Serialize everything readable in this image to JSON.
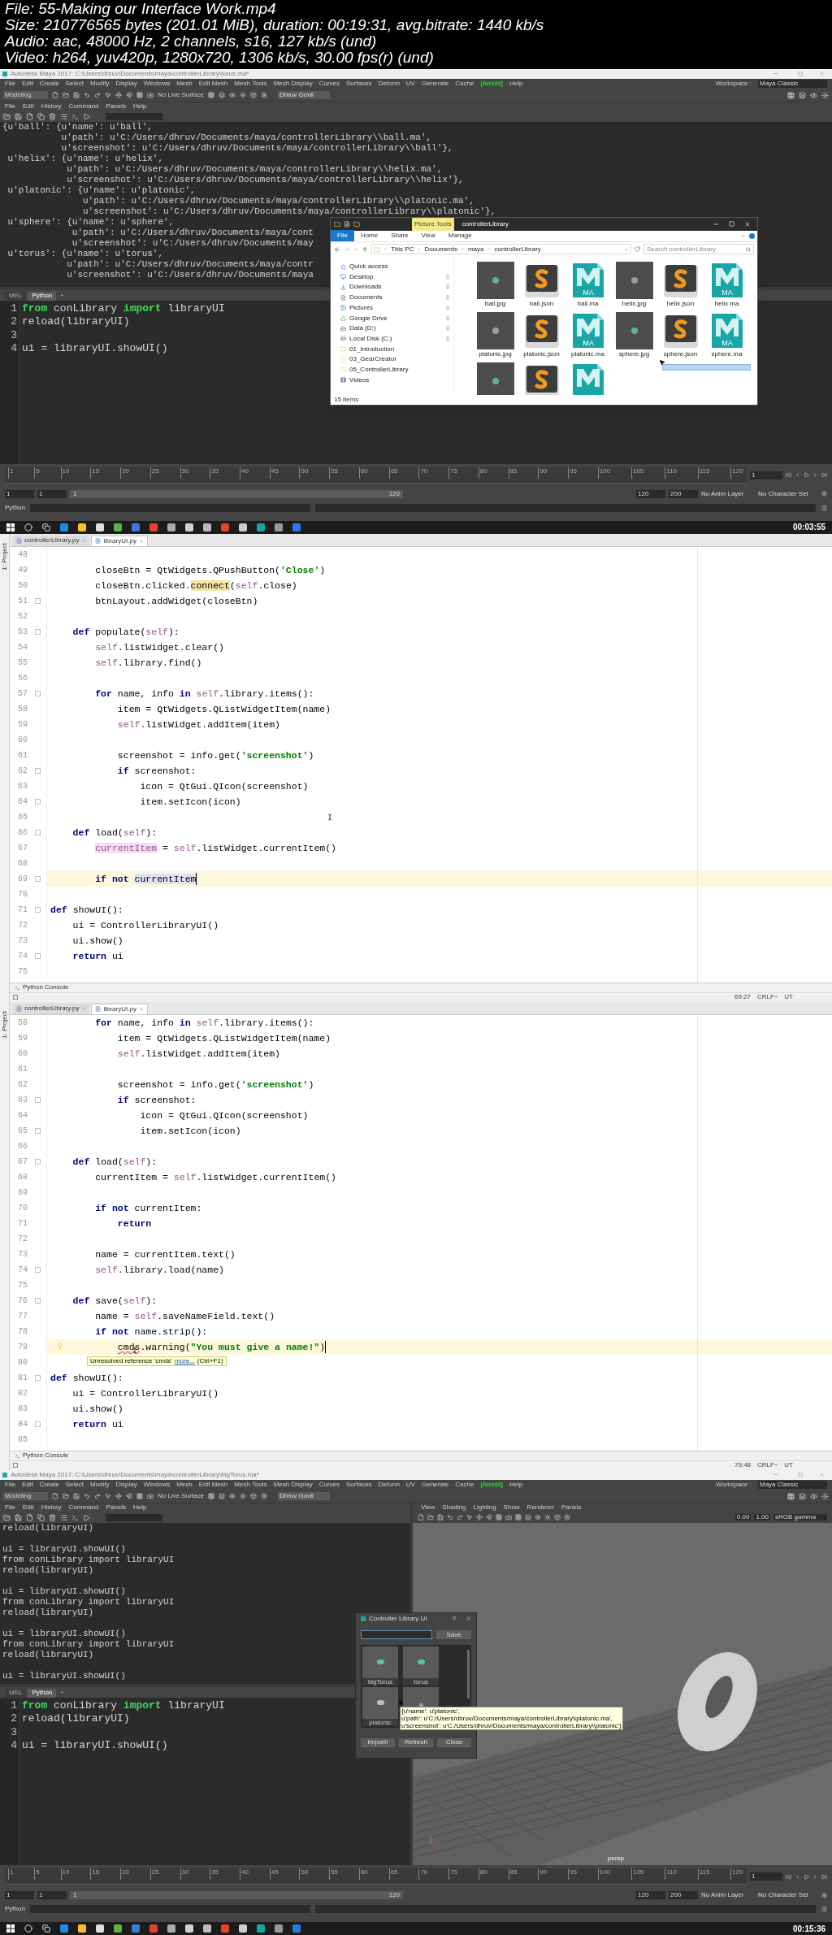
{
  "file_info": [
    "File: 55-Making our Interface Work.mp4",
    "Size: 210776565 bytes (201.01 MiB), duration: 00:19:31, avg.bitrate: 1440 kb/s",
    "Audio: aac, 48000 Hz, 2 channels, s16, 127 kb/s (und)",
    "Video: h264, yuv420p, 1280x720, 1306 kb/s, 30.00 fps(r) (und)"
  ],
  "frames": [
    {
      "kind": "maya",
      "title": "Autodesk Maya 2017: C:\\Users\\dhruv\\Documents\\maya\\controllerLibrary\\torus.ma*",
      "menu": [
        {
          "label": "File",
          "kind": "menu"
        },
        {
          "label": "Edit",
          "kind": "menu"
        },
        {
          "label": "Create",
          "kind": "menu"
        },
        {
          "label": "Select",
          "kind": "menu"
        },
        {
          "label": "Modify",
          "kind": "menu"
        },
        {
          "label": "Display",
          "kind": "menu"
        },
        {
          "label": "Windows",
          "kind": "menu"
        },
        {
          "label": "Mesh",
          "kind": "menu"
        },
        {
          "label": "Edit Mesh",
          "kind": "menu"
        },
        {
          "label": "Mesh Tools",
          "kind": "menu"
        },
        {
          "label": "Mesh Display",
          "kind": "menu"
        },
        {
          "label": "Curves",
          "kind": "menu"
        },
        {
          "label": "Surfaces",
          "kind": "menu"
        },
        {
          "label": "Deform",
          "kind": "menu"
        },
        {
          "label": "UV",
          "kind": "menu"
        },
        {
          "label": "Generate",
          "kind": "menu"
        },
        {
          "label": "Cache",
          "kind": "menu"
        },
        {
          "label": "[Arnold]",
          "kind": "plugin"
        },
        {
          "label": "Help",
          "kind": "menu"
        }
      ],
      "workspace_label": "Workspace :",
      "workspace": "Maya Classic",
      "mode": "Modeling",
      "live_surface": "No Live Surface",
      "user": "Dhruv Govil",
      "script_menu": [
        "File",
        "Edit",
        "History",
        "Command",
        "Panels",
        "Help"
      ],
      "output_blocks": [
        [
          "{u'ball': {u'name': u'ball',",
          "           u'path': u'C:/Users/dhruv/Documents/maya/controllerLibrary\\\\ball.ma',",
          "           u'screenshot': u'C:/Users/dhruv/Documents/maya/controllerLibrary\\\\ball'},",
          " u'helix': {u'name': u'helix',",
          "            u'path': u'C:/Users/dhruv/Documents/maya/controllerLibrary\\\\helix.ma',",
          "            u'screenshot': u'C:/Users/dhruv/Documents/maya/controllerLibrary\\\\helix'},",
          " u'platonic': {u'name': u'platonic',",
          "               u'path': u'C:/Users/dhruv/Documents/maya/controllerLibrary\\\\platonic.ma',",
          "               u'screenshot': u'C:/Users/dhruv/Documents/maya/controllerLibrary\\\\platonic'},",
          " u'sphere': {u'name': u'sphere',",
          "             u'path': u'C:/Users/dhruv/Documents/maya/cont",
          "             u'screenshot': u'C:/Users/dhruv/Documents/may",
          " u'torus': {u'name': u'torus',",
          "            u'path': u'C:/Users/dhruv/Documents/maya/contr",
          "            u'screenshot': u'C:/Users/dhruv/Documents/maya"
        ]
      ],
      "tabs": [
        {
          "label": "MEL",
          "selected": false
        },
        {
          "label": "Python",
          "selected": true
        }
      ],
      "add_tab": "+",
      "input": [
        {
          "n": "1",
          "code": [
            {
              "kind": "keyword",
              "text": "from"
            },
            {
              "kind": "plain",
              "text": " conLibrary "
            },
            {
              "kind": "keyword",
              "text": "import"
            },
            {
              "kind": "plain",
              "text": " libraryUI"
            }
          ]
        },
        {
          "n": "2",
          "code": [
            {
              "kind": "plain",
              "text": "reload(libraryUI)"
            }
          ]
        },
        {
          "n": "3"
        },
        {
          "n": "4",
          "code": [
            {
              "kind": "plain",
              "text": "ui = libraryUI.showUI()"
            }
          ]
        }
      ],
      "overlay": {
        "kind": "explorer",
        "ribbon_badge": "Picture Tools",
        "title": "controllerLibrary",
        "ribbon_tabs": [
          {
            "label": "File",
            "selected": true
          },
          {
            "label": "Home",
            "selected": false
          },
          {
            "label": "Share",
            "selected": false
          },
          {
            "label": "View",
            "selected": false
          },
          {
            "label": "Manage",
            "selected": false
          }
        ],
        "breadcrumb": [
          "This PC",
          "Documents",
          "maya",
          "controllerLibrary"
        ],
        "search_placeholder": "Search controllerLibrary",
        "nav": [
          {
            "label": "Quick access",
            "kind": "star",
            "pinned": false
          },
          {
            "label": "Desktop",
            "kind": "desktop",
            "pinned": true
          },
          {
            "label": "Downloads",
            "kind": "download",
            "pinned": true
          },
          {
            "label": "Documents",
            "kind": "document",
            "pinned": true
          },
          {
            "label": "Pictures",
            "kind": "picture",
            "pinned": true
          },
          {
            "label": "Google Drive",
            "kind": "drive",
            "pinned": true
          },
          {
            "label": "Data (D:)",
            "kind": "disk",
            "pinned": true
          },
          {
            "label": "Local Disk (C:)",
            "kind": "disk",
            "pinned": true
          },
          {
            "label": "01_Introduction",
            "kind": "folder",
            "pinned": false
          },
          {
            "label": "03_GearCreator",
            "kind": "folder",
            "pinned": false
          },
          {
            "label": "05_ControllerLibrary",
            "kind": "folder",
            "pinned": false
          },
          {
            "label": "Videos",
            "kind": "video",
            "pinned": false
          }
        ],
        "files": [
          {
            "name": "ball.jpg",
            "kind": "jpg",
            "color": "#5fb38f"
          },
          {
            "name": "ball.json",
            "kind": "json"
          },
          {
            "name": "ball.ma",
            "kind": "ma",
            "badge": "MA"
          },
          {
            "name": "helix.jpg",
            "kind": "jpg",
            "color": "#9a9a9a"
          },
          {
            "name": "helix.json",
            "kind": "json"
          },
          {
            "name": "helix.ma",
            "kind": "ma",
            "badge": "MA"
          },
          {
            "name": "platonic.jpg",
            "kind": "jpg",
            "color": "#a0a0a0"
          },
          {
            "name": "platonic.json",
            "kind": "json"
          },
          {
            "name": "platonic.ma",
            "kind": "ma",
            "badge": "MA"
          },
          {
            "name": "sphere.jpg",
            "kind": "jpg",
            "color": "#5fb38f"
          },
          {
            "name": "sphere.json",
            "kind": "json"
          },
          {
            "name": "sphere.ma",
            "kind": "ma",
            "badge": "MA"
          },
          {
            "kind": "jpg",
            "color": "#5fb38f"
          },
          {
            "kind": "json"
          },
          {
            "kind": "ma"
          }
        ],
        "status": "15 items"
      },
      "timeline": {
        "ticks": [
          "1",
          "5",
          "10",
          "15",
          "20",
          "25",
          "30",
          "35",
          "40",
          "45",
          "50",
          "55",
          "60",
          "65",
          "70",
          "75",
          "80",
          "85",
          "90",
          "95",
          "100",
          "105",
          "110",
          "115",
          "120"
        ],
        "current": "1"
      },
      "range": {
        "start": "1",
        "inner_start": "1",
        "slider_start": "1",
        "slider_end": "120",
        "level": 1,
        "end": "120",
        "max": "200",
        "anim_layer": "No Anim Layer",
        "char_set": "No Character Set"
      },
      "command_label": "Python",
      "taskbar": {
        "time": "00:03:55"
      }
    },
    {
      "kind": "pycharm",
      "project_label": "1: Project",
      "tabs": [
        {
          "label": "controllerLibrary.py",
          "selected": false
        },
        {
          "label": "libraryUI.py",
          "selected": true
        }
      ],
      "bulb": false,
      "lines": [
        {
          "n": "48",
          "fold": false,
          "current": false
        },
        {
          "n": "49",
          "fold": false,
          "current": false,
          "code": [
            {
              "kind": "plain",
              "text": "        closeBtn = QtWidgets.QPushButton("
            },
            {
              "kind": "string",
              "text": "'Close'"
            },
            {
              "kind": "plain",
              "text": ")"
            }
          ]
        },
        {
          "n": "50",
          "fold": false,
          "current": false,
          "code": [
            {
              "kind": "plain",
              "text": "        closeBtn.clicked."
            },
            {
              "kind": "match",
              "text": "connect"
            },
            {
              "kind": "plain",
              "text": "("
            },
            {
              "kind": "self",
              "text": "self"
            },
            {
              "kind": "plain",
              "text": ".close)"
            }
          ]
        },
        {
          "n": "51",
          "fold": true,
          "current": false,
          "code": [
            {
              "kind": "plain",
              "text": "        btnLayout.addWidget(closeBtn)"
            }
          ]
        },
        {
          "n": "52",
          "fold": false,
          "current": false
        },
        {
          "n": "53",
          "fold": true,
          "current": false,
          "code": [
            {
              "kind": "keyword",
              "text": "    def"
            },
            {
              "kind": "plain",
              "text": " populate("
            },
            {
              "kind": "self",
              "text": "self"
            },
            {
              "kind": "plain",
              "text": "):"
            }
          ]
        },
        {
          "n": "54",
          "fold": false,
          "current": false,
          "code": [
            {
              "kind": "self",
              "text": "        self"
            },
            {
              "kind": "plain",
              "text": ".listWidget.clear()"
            }
          ]
        },
        {
          "n": "55",
          "fold": false,
          "current": false,
          "code": [
            {
              "kind": "self",
              "text": "        self"
            },
            {
              "kind": "plain",
              "text": ".library.find()"
            }
          ]
        },
        {
          "n": "56",
          "fold": false,
          "current": false
        },
        {
          "n": "57",
          "fold": true,
          "current": false,
          "code": [
            {
              "kind": "keyword",
              "text": "        for"
            },
            {
              "kind": "plain",
              "text": " name, info "
            },
            {
              "kind": "keyword",
              "text": "in "
            },
            {
              "kind": "self",
              "text": "self"
            },
            {
              "kind": "plain",
              "text": ".library.items():"
            }
          ]
        },
        {
          "n": "58",
          "fold": false,
          "current": false,
          "code": [
            {
              "kind": "plain",
              "text": "            item = QtWidgets.QListWidgetItem(name)"
            }
          ]
        },
        {
          "n": "59",
          "fold": false,
          "current": false,
          "code": [
            {
              "kind": "self",
              "text": "            self"
            },
            {
              "kind": "plain",
              "text": ".listWidget.addItem(item)"
            }
          ]
        },
        {
          "n": "60",
          "fold": false,
          "current": false
        },
        {
          "n": "61",
          "fold": false,
          "current": false,
          "code": [
            {
              "kind": "plain",
              "text": "            screenshot = info.get("
            },
            {
              "kind": "string",
              "text": "'screenshot'"
            },
            {
              "kind": "plain",
              "text": ")"
            }
          ]
        },
        {
          "n": "62",
          "fold": true,
          "current": false,
          "code": [
            {
              "kind": "keyword",
              "text": "            if"
            },
            {
              "kind": "plain",
              "text": " screenshot:"
            }
          ]
        },
        {
          "n": "63",
          "fold": false,
          "current": false,
          "code": [
            {
              "kind": "plain",
              "text": "                icon = QtGui.QIcon(screenshot)"
            }
          ]
        },
        {
          "n": "64",
          "fold": true,
          "current": false,
          "code": [
            {
              "kind": "plain",
              "text": "                item.setIcon(icon)"
            }
          ]
        },
        {
          "n": "65",
          "fold": false,
          "current": false
        },
        {
          "n": "66",
          "fold": true,
          "current": false,
          "code": [
            {
              "kind": "keyword",
              "text": "    def"
            },
            {
              "kind": "plain",
              "text": " load("
            },
            {
              "kind": "self",
              "text": "self"
            },
            {
              "kind": "plain",
              "text": "):"
            }
          ]
        },
        {
          "n": "67",
          "fold": false,
          "current": false,
          "code": [
            {
              "kind": "unused",
              "text": "        currentItem"
            },
            {
              "kind": "plain",
              "text": " = "
            },
            {
              "kind": "self",
              "text": "self"
            },
            {
              "kind": "plain",
              "text": ".listWidget.currentItem()"
            }
          ]
        },
        {
          "n": "68",
          "fold": false,
          "current": false
        },
        {
          "n": "69",
          "fold": true,
          "current": true,
          "code": [
            {
              "kind": "keyword",
              "text": "        if not "
            },
            {
              "kind": "ref",
              "text": "currentItem"
            }
          ]
        },
        {
          "n": "70",
          "fold": false,
          "current": false
        },
        {
          "n": "71",
          "fold": true,
          "current": false,
          "code": [
            {
              "kind": "keyword",
              "text": "def"
            },
            {
              "kind": "plain",
              "text": " showUI():"
            }
          ]
        },
        {
          "n": "72",
          "fold": false,
          "current": false,
          "code": [
            {
              "kind": "plain",
              "text": "    ui = ControllerLibraryUI()"
            }
          ]
        },
        {
          "n": "73",
          "fold": false,
          "current": false,
          "code": [
            {
              "kind": "plain",
              "text": "    ui.show()"
            }
          ]
        },
        {
          "n": "74",
          "fold": true,
          "current": false,
          "code": [
            {
              "kind": "keyword",
              "text": "    return"
            },
            {
              "kind": "plain",
              "text": " ui"
            }
          ]
        },
        {
          "n": "75",
          "fold": false,
          "current": false
        }
      ],
      "console_tab": "Python Console",
      "status": [
        "69:27",
        "CRLF÷",
        "UT"
      ]
    },
    {
      "kind": "pycharm",
      "project_label": "1: Project",
      "tabs": [
        {
          "label": "controllerLibrary.py",
          "selected": false
        },
        {
          "label": "libraryUI.py",
          "selected": true
        }
      ],
      "bulb": true,
      "tooltip": {
        "text": "Unresolved reference 'cmds'",
        "link": "more...",
        "shortcut": "(Ctrl+F1)"
      },
      "lines": [
        {
          "n": "58",
          "fold": false,
          "current": false,
          "code": [
            {
              "kind": "keyword",
              "text": "        for"
            },
            {
              "kind": "plain",
              "text": " name, info "
            },
            {
              "kind": "keyword",
              "text": "in "
            },
            {
              "kind": "self",
              "text": "self"
            },
            {
              "kind": "plain",
              "text": ".library.items():"
            }
          ]
        },
        {
          "n": "59",
          "fold": false,
          "current": false,
          "code": [
            {
              "kind": "plain",
              "text": "            item = QtWidgets.QListWidgetItem(name)"
            }
          ]
        },
        {
          "n": "60",
          "fold": false,
          "current": false,
          "code": [
            {
              "kind": "self",
              "text": "            self"
            },
            {
              "kind": "plain",
              "text": ".listWidget.addItem(item)"
            }
          ]
        },
        {
          "n": "61",
          "fold": false,
          "current": false
        },
        {
          "n": "62",
          "fold": false,
          "current": false,
          "code": [
            {
              "kind": "plain",
              "text": "            screenshot = info.get("
            },
            {
              "kind": "string",
              "text": "'screenshot'"
            },
            {
              "kind": "plain",
              "text": ")"
            }
          ]
        },
        {
          "n": "63",
          "fold": true,
          "current": false,
          "code": [
            {
              "kind": "keyword",
              "text": "            if"
            },
            {
              "kind": "plain",
              "text": " screenshot:"
            }
          ]
        },
        {
          "n": "64",
          "fold": false,
          "current": false,
          "code": [
            {
              "kind": "plain",
              "text": "                icon = QtGui.QIcon(screenshot)"
            }
          ]
        },
        {
          "n": "65",
          "fold": true,
          "current": false,
          "code": [
            {
              "kind": "plain",
              "text": "                item.setIcon(icon)"
            }
          ]
        },
        {
          "n": "66",
          "fold": false,
          "current": false
        },
        {
          "n": "67",
          "fold": true,
          "current": false,
          "code": [
            {
              "kind": "keyword",
              "text": "    def"
            },
            {
              "kind": "plain",
              "text": " load("
            },
            {
              "kind": "self",
              "text": "self"
            },
            {
              "kind": "plain",
              "text": "):"
            }
          ]
        },
        {
          "n": "68",
          "fold": false,
          "current": false,
          "code": [
            {
              "kind": "plain",
              "text": "        currentItem = "
            },
            {
              "kind": "self",
              "text": "self"
            },
            {
              "kind": "plain",
              "text": ".listWidget.currentItem()"
            }
          ]
        },
        {
          "n": "69",
          "fold": false,
          "current": false
        },
        {
          "n": "70",
          "fold": false,
          "current": false,
          "code": [
            {
              "kind": "keyword",
              "text": "        if not"
            },
            {
              "kind": "plain",
              "text": " currentItem:"
            }
          ]
        },
        {
          "n": "71",
          "fold": false,
          "current": false,
          "code": [
            {
              "kind": "keyword",
              "text": "            return"
            }
          ]
        },
        {
          "n": "72",
          "fold": false,
          "current": false
        },
        {
          "n": "73",
          "fold": false,
          "current": false,
          "code": [
            {
              "kind": "plain",
              "text": "        name = currentItem.text()"
            }
          ]
        },
        {
          "n": "74",
          "fold": true,
          "current": false,
          "code": [
            {
              "kind": "self",
              "text": "        self"
            },
            {
              "kind": "plain",
              "text": ".library.load(name)"
            }
          ]
        },
        {
          "n": "75",
          "fold": false,
          "current": false
        },
        {
          "n": "76",
          "fold": true,
          "current": false,
          "code": [
            {
              "kind": "keyword",
              "text": "    def"
            },
            {
              "kind": "plain",
              "text": " save("
            },
            {
              "kind": "self",
              "text": "self"
            },
            {
              "kind": "plain",
              "text": "):"
            }
          ]
        },
        {
          "n": "77",
          "fold": false,
          "current": false,
          "code": [
            {
              "kind": "plain",
              "text": "        name = "
            },
            {
              "kind": "self",
              "text": "self"
            },
            {
              "kind": "plain",
              "text": ".saveNameField.text()"
            }
          ]
        },
        {
          "n": "78",
          "fold": false,
          "current": false,
          "code": [
            {
              "kind": "keyword",
              "text": "        if not"
            },
            {
              "kind": "plain",
              "text": " name.strip():"
            }
          ]
        },
        {
          "n": "79",
          "fold": false,
          "current": true,
          "code": [
            {
              "kind": "error",
              "text": "            cmds"
            },
            {
              "kind": "plain",
              "text": ".warning("
            },
            {
              "kind": "string",
              "text": "\"You must give a name!\""
            },
            {
              "kind": "plain",
              "text": ")"
            }
          ]
        },
        {
          "n": "80",
          "fold": false,
          "current": false
        },
        {
          "n": "81",
          "fold": true,
          "current": false,
          "code": [
            {
              "kind": "keyword",
              "text": "def"
            },
            {
              "kind": "plain",
              "text": " showUI():"
            }
          ]
        },
        {
          "n": "82",
          "fold": false,
          "current": false,
          "code": [
            {
              "kind": "plain",
              "text": "    ui = ControllerLibraryUI()"
            }
          ]
        },
        {
          "n": "83",
          "fold": false,
          "current": false,
          "code": [
            {
              "kind": "plain",
              "text": "    ui.show()"
            }
          ]
        },
        {
          "n": "84",
          "fold": true,
          "current": false,
          "code": [
            {
              "kind": "keyword",
              "text": "    return"
            },
            {
              "kind": "plain",
              "text": " ui"
            }
          ]
        },
        {
          "n": "85",
          "fold": false,
          "current": false
        }
      ],
      "console_tab": "Python Console",
      "status": [
        "79:48",
        "CRLF÷",
        "UT"
      ]
    },
    {
      "kind": "maya",
      "title": "Autodesk Maya 2017: C:\\Users\\dhruv\\Documents\\maya\\controllerLibrary\\bigTorus.ma*",
      "menu": [
        {
          "label": "File",
          "kind": "menu"
        },
        {
          "label": "Edit",
          "kind": "menu"
        },
        {
          "label": "Create",
          "kind": "menu"
        },
        {
          "label": "Select",
          "kind": "menu"
        },
        {
          "label": "Modify",
          "kind": "menu"
        },
        {
          "label": "Display",
          "kind": "menu"
        },
        {
          "label": "Windows",
          "kind": "menu"
        },
        {
          "label": "Mesh",
          "kind": "menu"
        },
        {
          "label": "Edit Mesh",
          "kind": "menu"
        },
        {
          "label": "Mesh Tools",
          "kind": "menu"
        },
        {
          "label": "Mesh Display",
          "kind": "menu"
        },
        {
          "label": "Curves",
          "kind": "menu"
        },
        {
          "label": "Surfaces",
          "kind": "menu"
        },
        {
          "label": "Deform",
          "kind": "menu"
        },
        {
          "label": "UV",
          "kind": "menu"
        },
        {
          "label": "Generate",
          "kind": "menu"
        },
        {
          "label": "Cache",
          "kind": "menu"
        },
        {
          "label": "[Arnold]",
          "kind": "plugin"
        },
        {
          "label": "Help",
          "kind": "menu"
        }
      ],
      "workspace_label": "Workspace :",
      "workspace": "Maya Classic",
      "mode": "Modeling",
      "live_surface": "No Live Surface",
      "user": "Dhruv Govil",
      "script_menu": [
        "File",
        "Edit",
        "History",
        "Command",
        "Panels",
        "Help"
      ],
      "output_blocks": [
        [
          "reload(libraryUI)"
        ],
        [
          "ui = libraryUI.showUI()",
          "from conLibrary import libraryUI",
          "reload(libraryUI)"
        ],
        [
          "ui = libraryUI.showUI()",
          "from conLibrary import libraryUI",
          "reload(libraryUI)"
        ],
        [
          "ui = libraryUI.showUI()",
          "from conLibrary import libraryUI",
          "reload(libraryUI)"
        ],
        [
          "ui = libraryUI.showUI()"
        ]
      ],
      "tabs": [
        {
          "label": "MEL",
          "selected": false
        },
        {
          "label": "Python",
          "selected": true
        }
      ],
      "add_tab": "+",
      "input": [
        {
          "n": "1",
          "code": [
            {
              "kind": "keyword",
              "text": "from"
            },
            {
              "kind": "plain",
              "text": " conLibrary "
            },
            {
              "kind": "keyword",
              "text": "import"
            },
            {
              "kind": "plain",
              "text": " libraryUI"
            }
          ]
        },
        {
          "n": "2",
          "code": [
            {
              "kind": "plain",
              "text": "reload(libraryUI)"
            }
          ]
        },
        {
          "n": "3"
        },
        {
          "n": "4",
          "code": [
            {
              "kind": "plain",
              "text": "ui = libraryUI.showUI()"
            }
          ]
        }
      ],
      "viewport": {
        "menu": [
          "View",
          "Shading",
          "Lighting",
          "Show",
          "Renderer",
          "Panels"
        ],
        "exposure": "0.00",
        "gamma": "1.00",
        "color_space": "sRGB gamma",
        "camera": "persp"
      },
      "overlay": {
        "kind": "dialog",
        "title": "Controller Library UI",
        "help": "?",
        "save": "Save",
        "items": [
          {
            "label": "bigTorus",
            "kind": "blob",
            "color": "#52c79a"
          },
          {
            "label": "torus",
            "kind": "blob",
            "color": "#52c79a"
          },
          {
            "label": "platonic",
            "kind": "blob",
            "color": "#bdbdbd"
          },
          {
            "kind": "stack",
            "color": "#9a9a9a"
          }
        ],
        "tooltip": [
          "{u'name': u'platonic',",
          "u'path': u'C:/Users/dhruv/Documents/maya/controllerLibrary\\\\platonic.ma',",
          "u'screenshot': u'C:/Users/dhruv/Documents/maya/controllerLibrary\\\\platonic'}"
        ],
        "buttons": [
          "Import!",
          "Refresh",
          "Close"
        ]
      },
      "timeline": {
        "ticks": [
          "1",
          "5",
          "10",
          "15",
          "20",
          "25",
          "30",
          "35",
          "40",
          "45",
          "50",
          "55",
          "60",
          "65",
          "70",
          "75",
          "80",
          "85",
          "90",
          "95",
          "100",
          "105",
          "110",
          "115",
          "120"
        ],
        "current": "1"
      },
      "range": {
        "start": "1",
        "inner_start": "1",
        "slider_start": "1",
        "slider_end": "120",
        "level": 1,
        "end": "120",
        "max": "200",
        "anim_layer": "No Anim Layer",
        "char_set": "No Character Set"
      },
      "command_label": "Python",
      "taskbar": {
        "time": "00:15:36"
      }
    }
  ]
}
